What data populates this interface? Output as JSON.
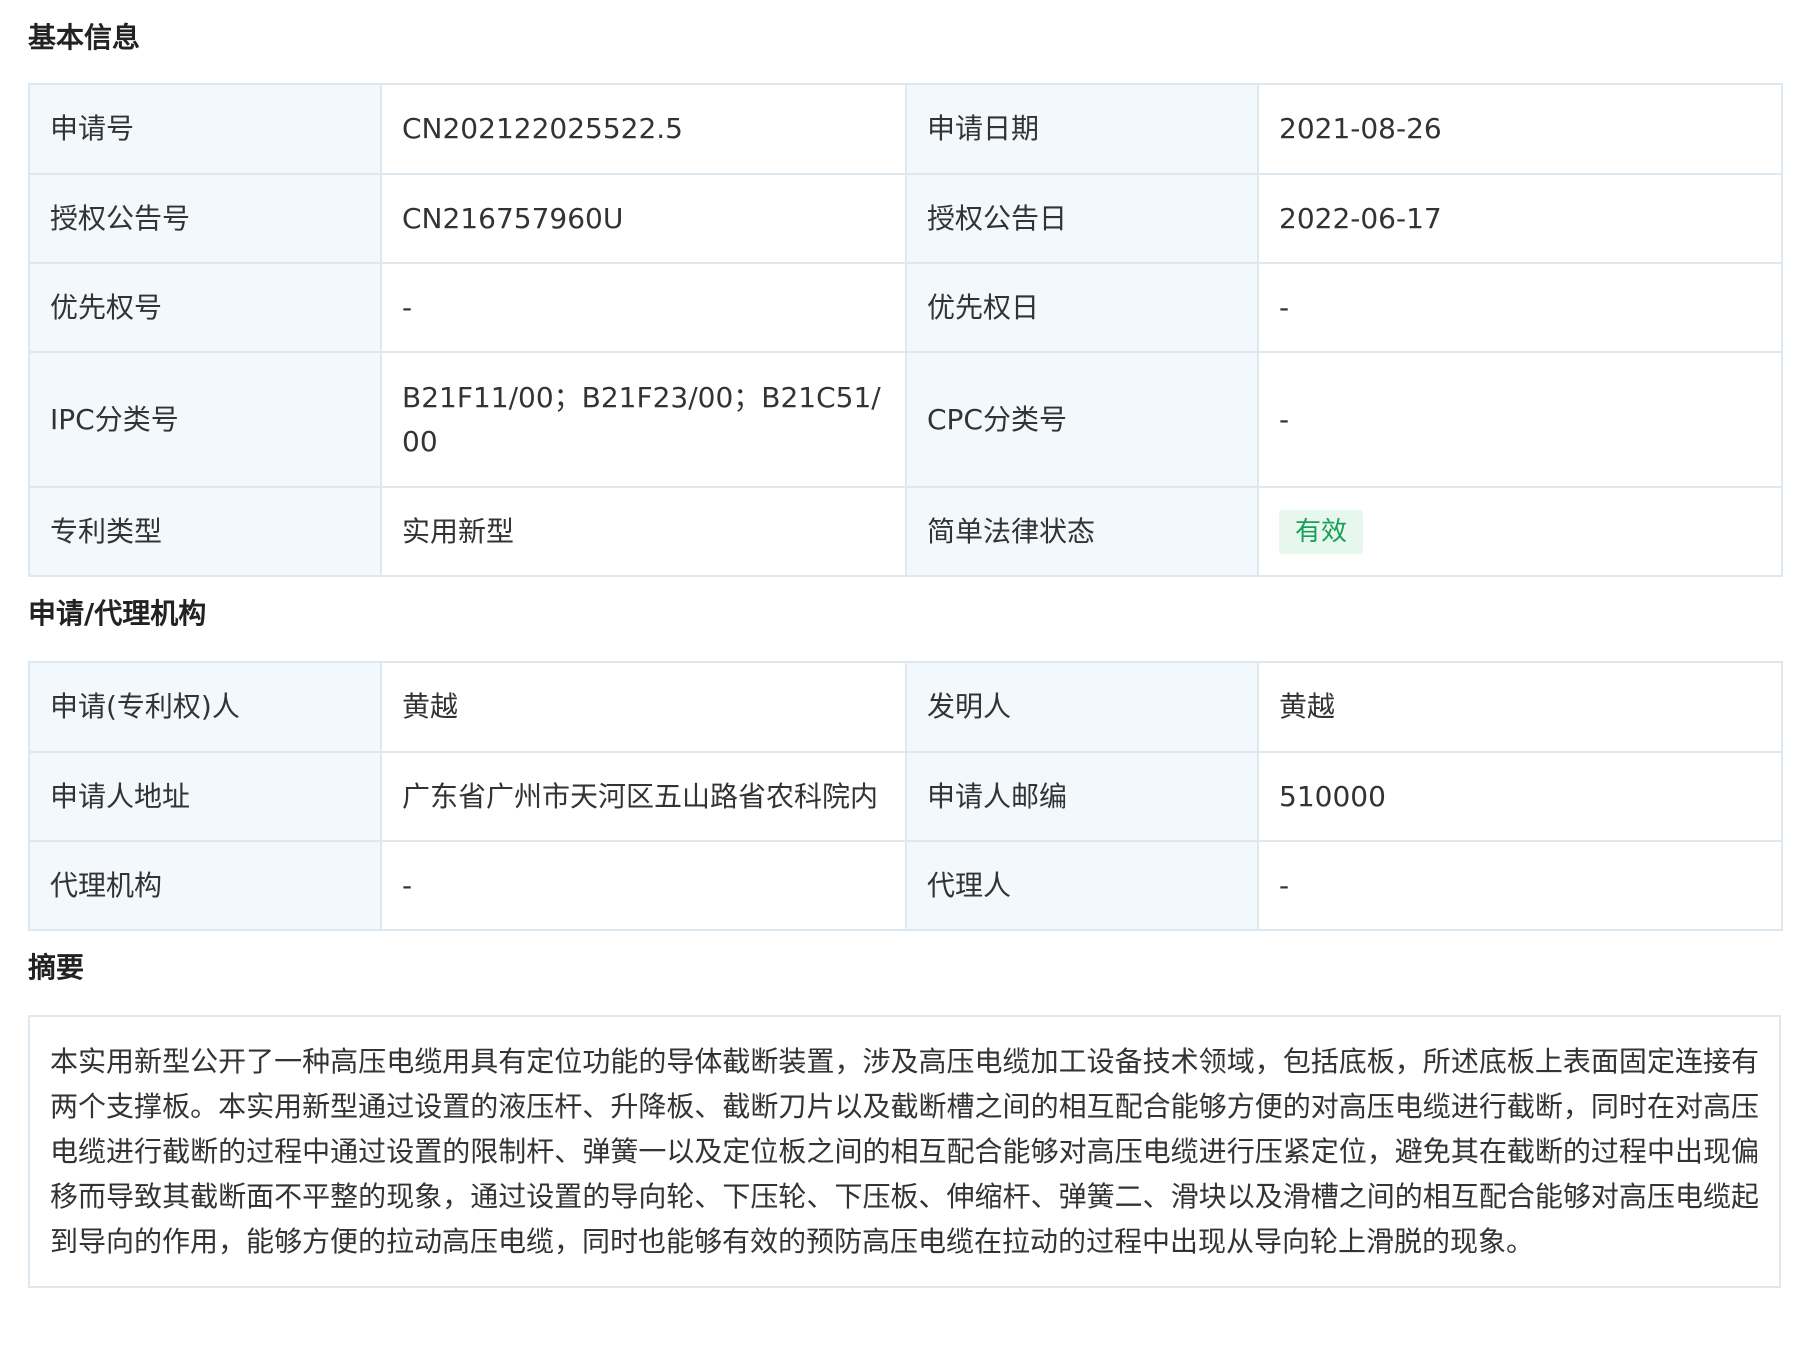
{
  "basic_info": {
    "title": "基本信息",
    "rows": [
      {
        "l1": "申请号",
        "v1": "CN202122025522.5",
        "l2": "申请日期",
        "v2": "2021-08-26"
      },
      {
        "l1": "授权公告号",
        "v1": "CN216757960U",
        "l2": "授权公告日",
        "v2": "2022-06-17"
      },
      {
        "l1": "优先权号",
        "v1": "-",
        "l2": "优先权日",
        "v2": "-"
      },
      {
        "l1": "IPC分类号",
        "v1": "B21F11/00；B21F23/00；B21C51/00",
        "l2": "CPC分类号",
        "v2": "-"
      },
      {
        "l1": "专利类型",
        "v1": "实用新型",
        "l2": "简单法律状态",
        "v2": "有效"
      }
    ],
    "status_badge_color": "#18a058",
    "status_badge_bg": "#e7f7ee"
  },
  "agency": {
    "title": "申请/代理机构",
    "rows": [
      {
        "l1": "申请(专利权)人",
        "v1": "黄越",
        "l2": "发明人",
        "v2": "黄越"
      },
      {
        "l1": "申请人地址",
        "v1": "广东省广州市天河区五山路省农科院内",
        "l2": "申请人邮编",
        "v2": "510000"
      },
      {
        "l1": "代理机构",
        "v1": "-",
        "l2": "代理人",
        "v2": "-"
      }
    ]
  },
  "abstract": {
    "title": "摘要",
    "text": "本实用新型公开了一种高压电缆用具有定位功能的导体截断装置，涉及高压电缆加工设备技术领域，包括底板，所述底板上表面固定连接有两个支撑板。本实用新型通过设置的液压杆、升降板、截断刀片以及截断槽之间的相互配合能够方便的对高压电缆进行截断，同时在对高压电缆进行截断的过程中通过设置的限制杆、弹簧一以及定位板之间的相互配合能够对高压电缆进行压紧定位，避免其在截断的过程中出现偏移而导致其截断面不平整的现象，通过设置的导向轮、下压轮、下压板、伸缩杆、弹簧二、滑块以及滑槽之间的相互配合能够对高压电缆起到导向的作用，能够方便的拉动高压电缆，同时也能够有效的预防高压电缆在拉动的过程中出现从导向轮上滑脱的现象。"
  },
  "colors": {
    "label_bg": "#f2f8fc",
    "border": "#dde8f0",
    "text": "#333333"
  }
}
